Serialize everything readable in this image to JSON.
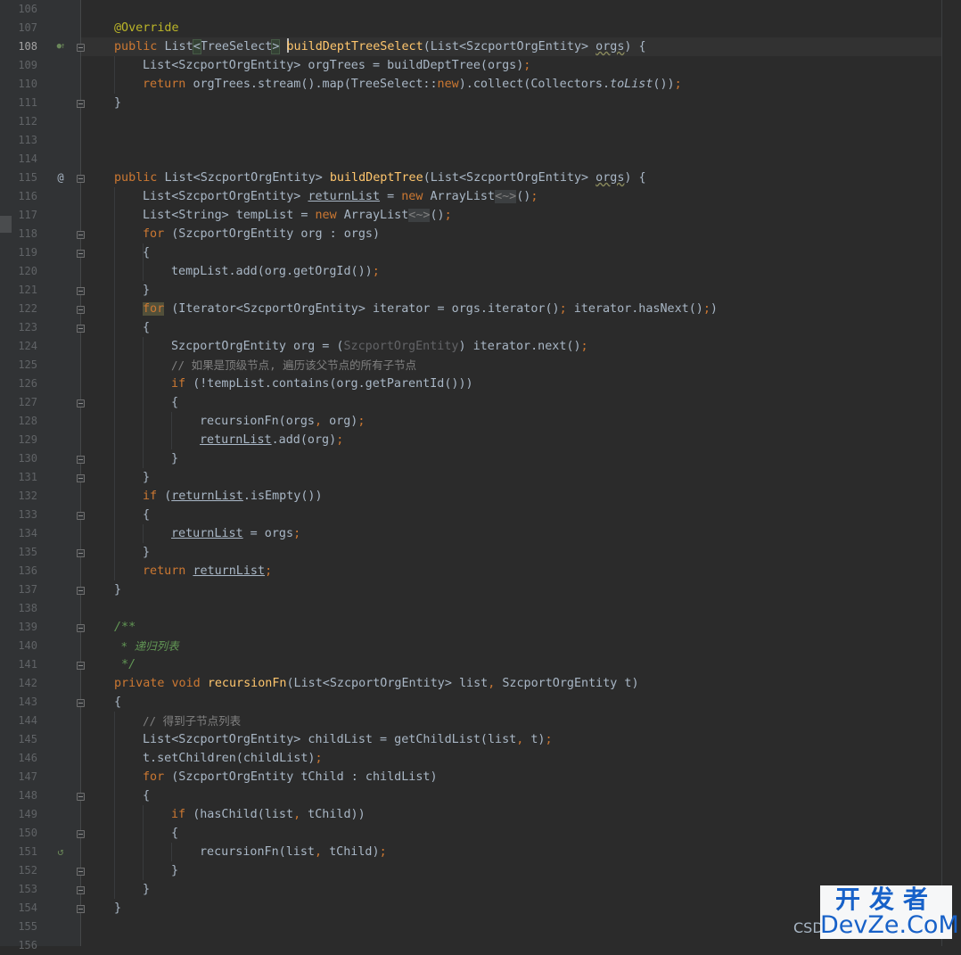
{
  "editor": {
    "language": "Java",
    "first_line_number": 106,
    "current_line": 108,
    "line_numbers": [
      "106",
      "107",
      "108",
      "109",
      "110",
      "111",
      "112",
      "113",
      "114",
      "115",
      "116",
      "117",
      "118",
      "119",
      "120",
      "121",
      "122",
      "123",
      "124",
      "125",
      "126",
      "127",
      "128",
      "129",
      "130",
      "131",
      "132",
      "133",
      "134",
      "135",
      "136",
      "137",
      "138",
      "139",
      "140",
      "141",
      "142",
      "143",
      "144",
      "145",
      "146",
      "147",
      "148",
      "149",
      "150",
      "151",
      "152",
      "153",
      "154",
      "155",
      "156"
    ],
    "gutter_icons": [
      {
        "line": "108",
        "name": "implements-icon",
        "glyph": "●↑"
      },
      {
        "line": "115",
        "name": "at-icon",
        "glyph": "@"
      },
      {
        "line": "151",
        "name": "recursion-icon",
        "glyph": "↺"
      }
    ],
    "code": {
      "l107": "@Override",
      "l108_kw": "public ",
      "l108_t1": "List",
      "l108_lt": "<",
      "l108_t2": "TreeSelect",
      "l108_gt": ">",
      "l108_fn": "buildDeptTreeSelect",
      "l108_p1": "(List<SzcportOrgEntity> ",
      "l108_p2": "orgs",
      "l108_p3": ") {",
      "l109": "List<SzcportOrgEntity> orgTrees = buildDeptTree(orgs)",
      "l110_kw": "return ",
      "l110_a": "orgTrees.stream().map(TreeSelect::",
      "l110_new": "new",
      "l110_b": ").collect(Collectors.",
      "l110_it": "toList",
      "l110_c": "())",
      "l111": "}",
      "l115_kw": "public ",
      "l115_a": "List<SzcportOrgEntity> ",
      "l115_fn": "buildDeptTree",
      "l115_b": "(List<SzcportOrgEntity> ",
      "l115_p": "orgs",
      "l115_c": ") {",
      "l116_a": "List<SzcportOrgEntity> ",
      "l116_v": "returnList",
      "l116_b": " = ",
      "l116_new": "new ",
      "l116_c": "ArrayList",
      "l116_ph": "<~>",
      "l116_d": "()",
      "l117_a": "List<String> tempList = ",
      "l117_new": "new ",
      "l117_c": "ArrayList",
      "l117_ph": "<~>",
      "l117_d": "()",
      "l118_kw": "for ",
      "l118_a": "(SzcportOrgEntity org : orgs)",
      "l119": "{",
      "l120": "tempList.add(org.getOrgId())",
      "l121": "}",
      "l122_kw": "for",
      "l122_a": " (Iterator<SzcportOrgEntity> iterator = orgs.iterator()",
      "l122_b": " iterator.hasNext()",
      "l122_c": ")",
      "l123": "{",
      "l124_a": "SzcportOrgEntity org = (",
      "l124_cast": "SzcportOrgEntity",
      "l124_b": ") iterator.next()",
      "l125": "// 如果是顶级节点, 遍历该父节点的所有子节点",
      "l126_kw": "if ",
      "l126_a": "(!tempList.contains(org.getParentId()))",
      "l127": "{",
      "l128_a": "recursionFn(orgs",
      "l128_b": " org)",
      "l129_v": "returnList",
      "l129_a": ".add(org)",
      "l130": "}",
      "l131": "}",
      "l132_kw": "if ",
      "l132_a": "(",
      "l132_v": "returnList",
      "l132_b": ".isEmpty())",
      "l133": "{",
      "l134_v": "returnList",
      "l134_a": " = orgs",
      "l135": "}",
      "l136_kw": "return ",
      "l136_v": "returnList",
      "l137": "}",
      "l139": "/**",
      "l140": " * 递归列表",
      "l141": " */",
      "l142_kw": "private void ",
      "l142_fn": "recursionFn",
      "l142_a": "(List<SzcportOrgEntity> list",
      "l142_b": " SzcportOrgEntity t)",
      "l143": "{",
      "l144": "// 得到子节点列表",
      "l145_a": "List<SzcportOrgEntity> childList = getChildList(list",
      "l145_b": " t)",
      "l146": "t.setChildren(childList)",
      "l147_kw": "for ",
      "l147_a": "(SzcportOrgEntity tChild : childList)",
      "l148": "{",
      "l149_kw": "if ",
      "l149_a": "(hasChild(list",
      "l149_b": " tChild))",
      "l150": "{",
      "l151_a": "recursionFn(list",
      "l151_b": " tChild)",
      "l152": "}",
      "l153": "}",
      "l154": "}",
      "semi": ";",
      "comma": ","
    }
  },
  "watermark": {
    "top": "开发者",
    "bottom": "DevZe.CoM",
    "prefix": "CSD"
  },
  "colors": {
    "background": "#2b2b2b",
    "gutter": "#313335",
    "keyword": "#cc7832",
    "method": "#ffc66d",
    "annotation": "#bbb529",
    "comment": "#808080",
    "doc_comment": "#629755",
    "text": "#a9b7c6",
    "watermark_blue": "#1761c8"
  }
}
